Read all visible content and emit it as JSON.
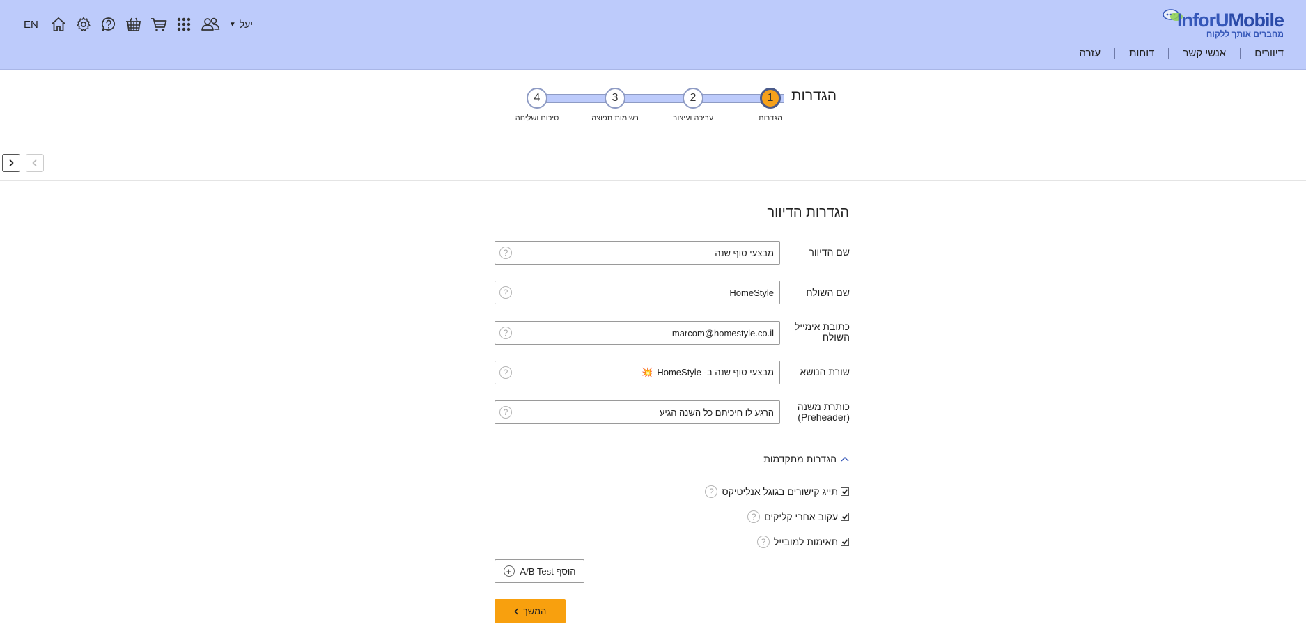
{
  "logo": {
    "name_part1": "InforU",
    "name_part2": "Mobile",
    "tagline": "מחברים אותך ללקוח"
  },
  "main_nav": {
    "items": [
      {
        "label": "דיוורים"
      },
      {
        "label": "אנשי קשר"
      },
      {
        "label": "דוחות"
      },
      {
        "label": "עזרה"
      }
    ]
  },
  "toolbar": {
    "language": "EN",
    "user_name": "יעל",
    "icons": [
      "home-icon",
      "gear-icon",
      "help-icon",
      "basket-icon",
      "cart-icon",
      "apps-grid-icon",
      "users-icon"
    ]
  },
  "wizard": {
    "title": "הגדרות",
    "steps": [
      {
        "number": "1",
        "label": "הגדרות",
        "active": true
      },
      {
        "number": "2",
        "label": "עריכה ועיצוב",
        "active": false
      },
      {
        "number": "3",
        "label": "רשימות תפוצה",
        "active": false
      },
      {
        "number": "4",
        "label": "סיכום ושליחה",
        "active": false
      }
    ],
    "accent_color": "#f6a11b"
  },
  "form": {
    "section_title": "הגדרות הדיוור",
    "fields": [
      {
        "label": "שם הדיוור",
        "value": "מבצעי סוף שנה"
      },
      {
        "label": "שם השולח",
        "value": "HomeStyle"
      },
      {
        "label": "כתובת אימייל השולח",
        "value": "marcom@homestyle.co.il"
      },
      {
        "label": "שורת הנושא",
        "value": "מבצעי סוף שנה ב- HomeStyle",
        "emoji": "💥"
      },
      {
        "label": "כותרת משנה (Preheader)",
        "value": "הרגע לו חיכיתם כל השנה הגיע"
      }
    ],
    "advanced": {
      "toggle_label": "הגדרות מתקדמות",
      "options": [
        {
          "label": "תייג קישורים בגוגל אנליטיקס",
          "checked": true
        },
        {
          "label": "עקוב אחרי קליקים",
          "checked": true
        },
        {
          "label": "תאימות למובייל",
          "checked": true
        }
      ]
    },
    "ab_test_label": "הוסף A/B Test",
    "next_label": "המשך",
    "help_symbol": "?"
  },
  "colors": {
    "header_bg": "#bdcbfb",
    "primary_button": "#f8a00e"
  }
}
